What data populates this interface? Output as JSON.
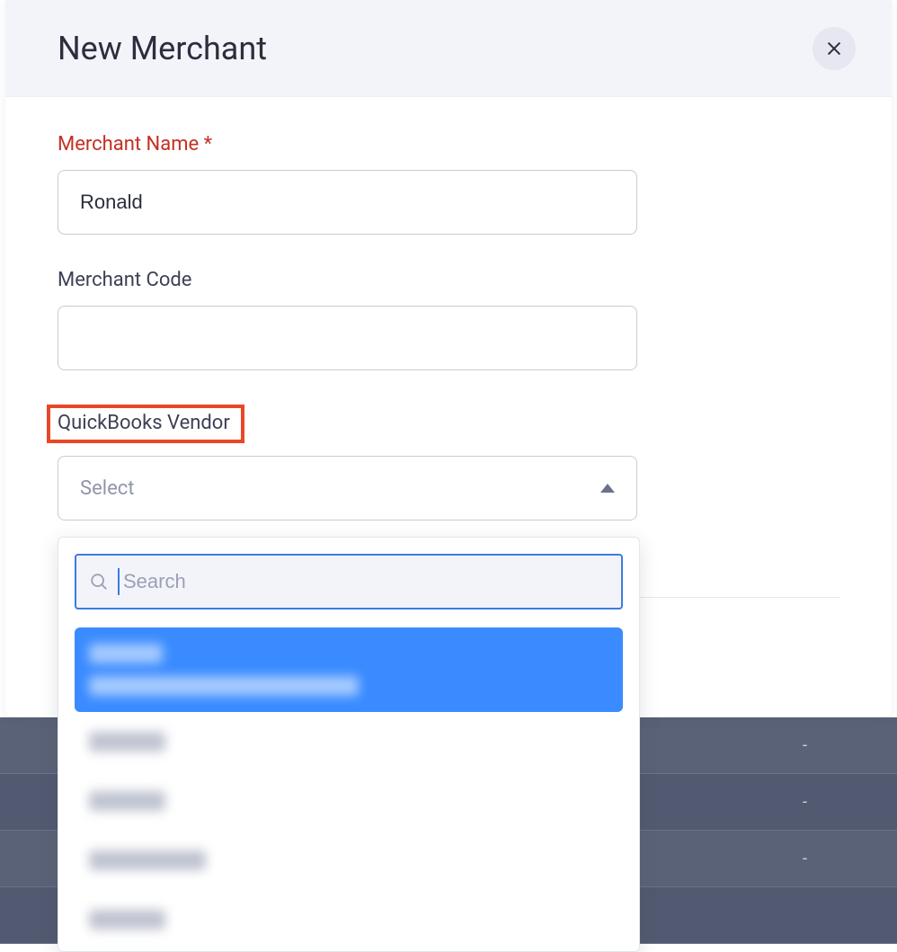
{
  "header": {
    "title": "New Merchant",
    "close_aria": "Close"
  },
  "fields": {
    "merchant_name": {
      "label": "Merchant Name *",
      "value": "Ronald"
    },
    "merchant_code": {
      "label": "Merchant Code",
      "value": ""
    },
    "quickbooks_vendor": {
      "label": "QuickBooks Vendor",
      "placeholder": "Select",
      "search_placeholder": "Search",
      "options": [
        {
          "name": "",
          "detail": "",
          "selected": true
        },
        {
          "name": "",
          "detail": "",
          "selected": false
        },
        {
          "name": "",
          "detail": "",
          "selected": false
        },
        {
          "name": "",
          "detail": "",
          "selected": false
        },
        {
          "name": "",
          "detail": "",
          "selected": false
        }
      ]
    }
  },
  "bg_rows": [
    "-",
    "-",
    "-"
  ]
}
